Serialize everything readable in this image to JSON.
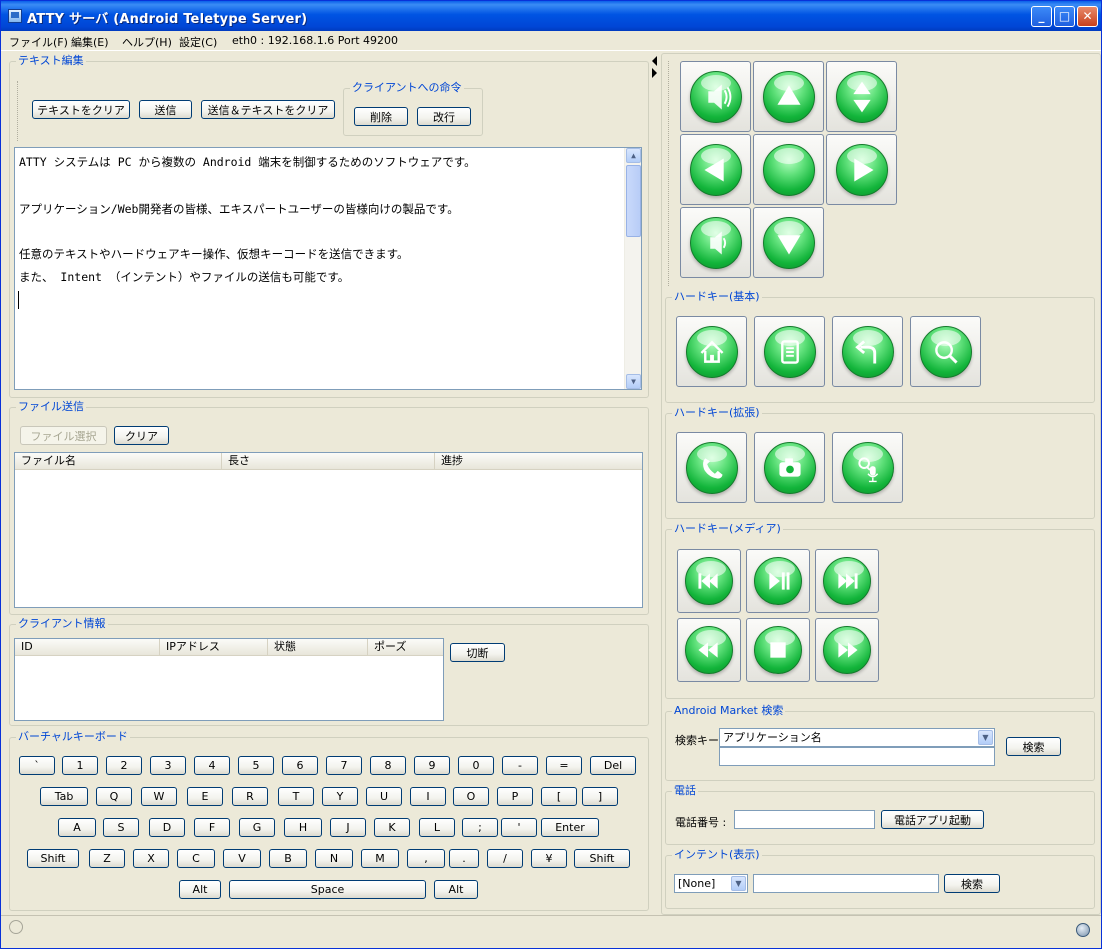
{
  "window": {
    "title": "ATTY サーバ (Android Teletype Server)"
  },
  "menu": {
    "file": "ファイル(F)",
    "edit": "編集(E)",
    "help": "ヘルプ(H)",
    "settings": "設定(C)",
    "status": "eth0 : 192.168.1.6 Port 49200"
  },
  "text_edit": {
    "label": "テキスト編集",
    "clear_btn": "テキストをクリア",
    "send_btn": "送信",
    "send_clear_btn": "送信＆テキストをクリア",
    "client_cmd_label": "クライアントへの命令",
    "delete_btn": "削除",
    "newline_btn": "改行",
    "lines": [
      "ATTY システムは PC から複数の Android 端末を制御するためのソフトウェアです。",
      "",
      "アプリケーション/Web開発者の皆様、エキスパートユーザーの皆様向けの製品です。",
      "",
      "任意のテキストやハードウェアキー操作、仮想キーコードを送信できます。",
      "また、 Intent （インテント）やファイルの送信も可能です。"
    ]
  },
  "file_send": {
    "label": "ファイル送信",
    "select_btn": "ファイル選択",
    "clear_btn": "クリア",
    "columns": [
      "ファイル名",
      "長さ",
      "進捗"
    ]
  },
  "client_info": {
    "label": "クライアント情報",
    "columns": [
      "ID",
      "IPアドレス",
      "状態",
      "ポーズ"
    ],
    "disconnect_btn": "切断"
  },
  "keyboard": {
    "label": "バーチャルキーボード",
    "row1": [
      "`",
      "1",
      "2",
      "3",
      "4",
      "5",
      "6",
      "7",
      "8",
      "9",
      "0",
      "-",
      "=",
      "Del"
    ],
    "row2": [
      "Tab",
      "Q",
      "W",
      "E",
      "R",
      "T",
      "Y",
      "U",
      "I",
      "O",
      "P",
      "[",
      "]"
    ],
    "row3": [
      "A",
      "S",
      "D",
      "F",
      "G",
      "H",
      "J",
      "K",
      "L",
      ";",
      "'",
      "Enter"
    ],
    "row4": [
      "Shift",
      "Z",
      "X",
      "C",
      "V",
      "B",
      "N",
      "M",
      ",",
      ".",
      "/",
      "¥",
      "Shift"
    ],
    "row5": [
      "Alt",
      "Space",
      "Alt"
    ]
  },
  "hardkeys": {
    "basic_label": "ハードキー(基本)",
    "extended_label": "ハードキー(拡張)",
    "media_label": "ハードキー(メディア)"
  },
  "market": {
    "label": "Android Market 検索",
    "key_label": "検索キー",
    "key_value": "アプリケーション名",
    "search_btn": "検索"
  },
  "phone": {
    "label": "電話",
    "number_label": "電話番号 :",
    "launch_btn": "電話アプリ起動"
  },
  "intent": {
    "label": "インテント(表示)",
    "type_value": "[None]",
    "search_btn": "検索"
  },
  "colors": {
    "title_blue": "#0054e3",
    "group_label": "#0046d5",
    "orb_green": "#12b43a"
  }
}
